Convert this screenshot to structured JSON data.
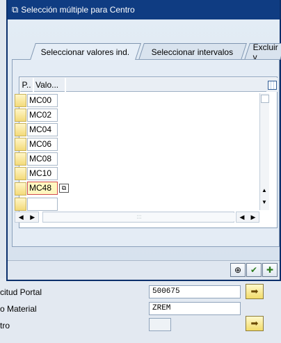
{
  "dialog": {
    "title": "Selección múltiple para Centro",
    "tabs": [
      {
        "label": "Seleccionar valores ind."
      },
      {
        "label": "Seleccionar intervalos"
      },
      {
        "label": "Excluir v"
      }
    ],
    "table": {
      "headers": [
        "P..",
        "Valo..."
      ],
      "rows": [
        "MC00",
        "MC02",
        "MC04",
        "MC06",
        "MC08",
        "MC10",
        "MC48",
        ""
      ]
    },
    "hscroll_dots": ":::",
    "footer_buttons": [
      "execute-icon",
      "check-icon",
      "multi-check-icon"
    ]
  },
  "background_form": {
    "rows": [
      {
        "label": "citud Portal",
        "value": "500675"
      },
      {
        "label": "o Material",
        "value": "ZREM"
      },
      {
        "label": "tro",
        "value": ""
      }
    ]
  },
  "colors": {
    "title_bar": "#0f3c82",
    "row_selector": "#f3da7a",
    "focus_border": "#d24b4b"
  }
}
